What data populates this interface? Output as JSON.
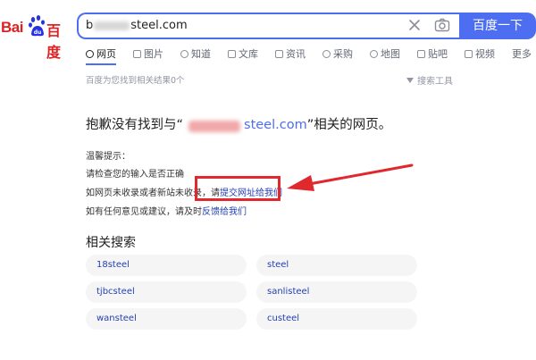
{
  "logo": {
    "latin": "Bai",
    "cn": "百度",
    "icon": "paw-icon"
  },
  "search": {
    "query": "b ...steel.com",
    "query_visible_start": "b",
    "query_visible_end": "steel.com",
    "button_label": "百度一下"
  },
  "tabs": [
    {
      "label": "网页",
      "icon": "search-icon",
      "active": true
    },
    {
      "label": "图片",
      "icon": "image-icon"
    },
    {
      "label": "知道",
      "icon": "question-icon"
    },
    {
      "label": "文库",
      "icon": "document-icon"
    },
    {
      "label": "资讯",
      "icon": "news-icon"
    },
    {
      "label": "采购",
      "icon": "cart-icon"
    },
    {
      "label": "地图",
      "icon": "map-icon"
    },
    {
      "label": "贴吧",
      "icon": "forum-icon"
    },
    {
      "label": "视频",
      "icon": "video-icon"
    },
    {
      "label": "更多",
      "icon": ""
    }
  ],
  "result_info": "百度为您找到相关结果0个",
  "tools_label": "搜索工具",
  "not_found": {
    "prefix": "抱歉没有找到与“",
    "url_visible": "steel.com",
    "suffix": "”相关的网页。"
  },
  "tips": {
    "heading": "温馨提示：",
    "line1": "请检查您的输入是否正确",
    "line2_text": "如网页未收录或者新站未收录，请",
    "line2_link": "提交网址给我们",
    "line3_text": "如有任何意见或建议，请及时",
    "line3_link": "反馈给我们"
  },
  "related": {
    "title": "相关搜索",
    "items": [
      "18steel",
      "steel",
      "tjbcsteel",
      "sanlisteel",
      "wansteel",
      "custeel"
    ]
  },
  "colors": {
    "brand_blue": "#4e6ef2",
    "logo_red": "#dd2222",
    "annotation_red": "#e0282d",
    "link_blue": "#2440b3"
  }
}
